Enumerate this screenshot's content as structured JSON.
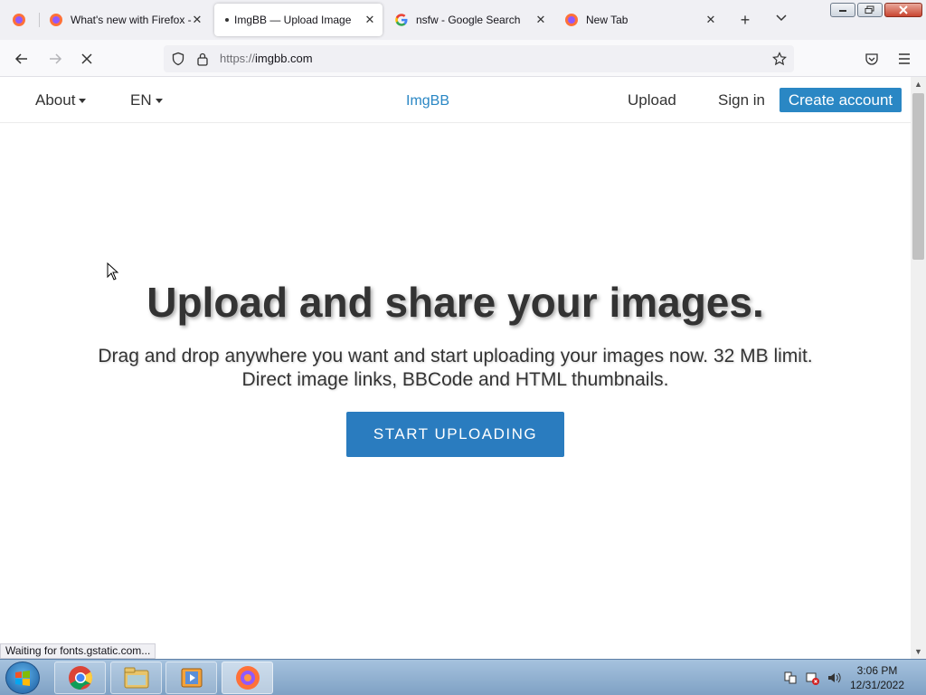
{
  "browser": {
    "tabs": [
      {
        "title": "What's new with Firefox -",
        "active": false
      },
      {
        "title": "ImgBB — Upload Image",
        "active": true
      },
      {
        "title": "nsfw - Google Search",
        "active": false
      },
      {
        "title": "New Tab",
        "active": false
      }
    ],
    "url_scheme": "https://",
    "url_host": "imgbb.com",
    "status_text": "Waiting for fonts.gstatic.com..."
  },
  "site": {
    "nav": {
      "about": "About",
      "language": "EN",
      "brand": "ImgBB",
      "upload": "Upload",
      "sign_in": "Sign in",
      "create_account": "Create account"
    },
    "hero": {
      "title": "Upload and share your images.",
      "subtitle": "Drag and drop anywhere you want and start uploading your images now. 32 MB limit. Direct image links, BBCode and HTML thumbnails.",
      "cta": "START UPLOADING"
    },
    "colors": {
      "brand": "#2a87c4",
      "cta": "#2a7cbf",
      "text": "#333333"
    }
  },
  "taskbar": {
    "apps": [
      "chrome-icon",
      "file-explorer-icon",
      "media-player-icon",
      "firefox-icon"
    ],
    "time": "3:06 PM",
    "date": "12/31/2022"
  }
}
